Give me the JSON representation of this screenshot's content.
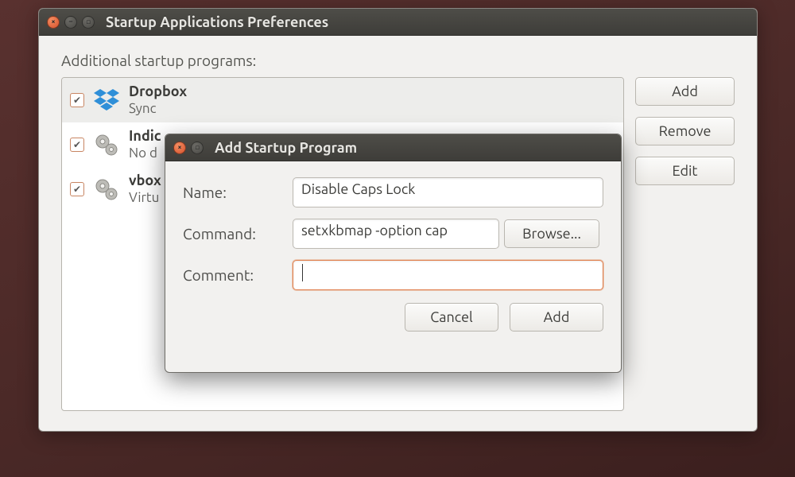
{
  "parentWindow": {
    "title": "Startup Applications Preferences",
    "sectionLabel": "Additional startup programs:",
    "items": [
      {
        "name": "Dropbox",
        "desc": "Sync",
        "icon": "dropbox",
        "checked": true,
        "selected": true
      },
      {
        "name": "Indic",
        "desc": "No d",
        "icon": "gears",
        "checked": true,
        "selected": false
      },
      {
        "name": "vbox",
        "desc": "Virtu",
        "icon": "gears",
        "checked": true,
        "selected": false
      }
    ],
    "buttons": {
      "add": "Add",
      "remove": "Remove",
      "edit": "Edit"
    }
  },
  "dialog": {
    "title": "Add Startup Program",
    "labels": {
      "name": "Name:",
      "command": "Command:",
      "comment": "Comment:"
    },
    "values": {
      "name": "Disable Caps Lock",
      "command": "setxkbmap -option cap",
      "comment": ""
    },
    "buttons": {
      "browse": "Browse...",
      "cancel": "Cancel",
      "add": "Add"
    }
  }
}
